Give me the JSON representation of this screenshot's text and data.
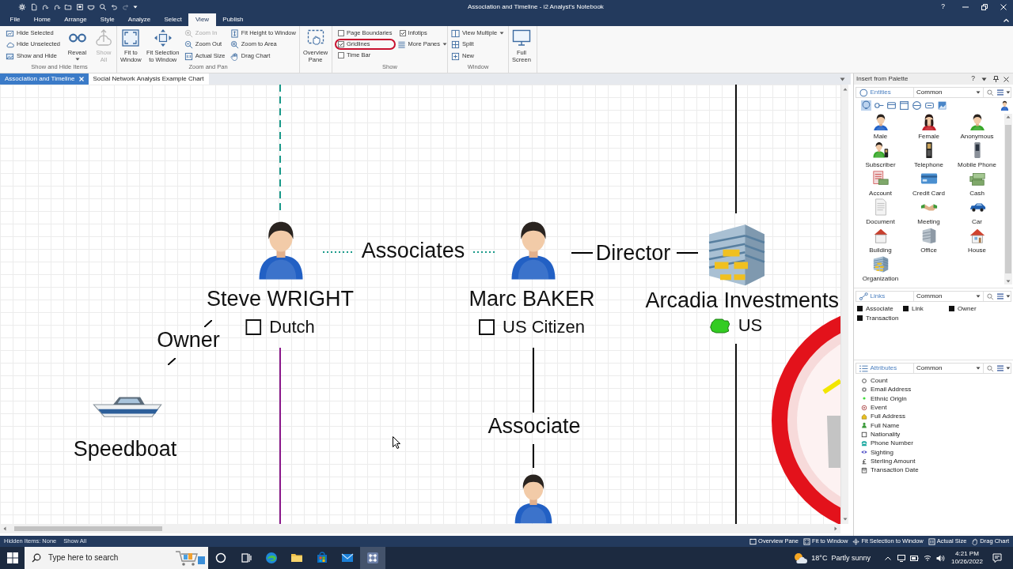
{
  "window": {
    "title": "Association and Timeline - i2 Analyst's Notebook",
    "help": "?"
  },
  "menu_tabs": [
    {
      "label": "File",
      "selected": false
    },
    {
      "label": "Home",
      "selected": false
    },
    {
      "label": "Arrange",
      "selected": false
    },
    {
      "label": "Style",
      "selected": false
    },
    {
      "label": "Analyze",
      "selected": false
    },
    {
      "label": "Select",
      "selected": false
    },
    {
      "label": "View",
      "selected": true
    },
    {
      "label": "Publish",
      "selected": false
    }
  ],
  "ribbon": {
    "groups": [
      {
        "title": "Show and Hide Items",
        "columns": [
          [
            {
              "kind": "small",
              "label": "Hide Selected",
              "disabled": false,
              "dropdown": false
            },
            {
              "kind": "small",
              "label": "Hide Unselected",
              "disabled": false,
              "dropdown": false
            },
            {
              "kind": "small",
              "label": "Show and Hide",
              "disabled": false,
              "dropdown": false
            }
          ],
          [
            {
              "kind": "large",
              "label": "Reveal",
              "disabled": false,
              "dropdown": true
            }
          ],
          [
            {
              "kind": "large",
              "label": "Show\nAll",
              "disabled": true,
              "dropdown": false
            }
          ]
        ]
      },
      {
        "title": "Zoom and Pan",
        "columns": [
          [
            {
              "kind": "large",
              "label": "Fit to\nWindow",
              "disabled": false,
              "dropdown": false
            }
          ],
          [
            {
              "kind": "large",
              "label": "Fit Selection\nto Window",
              "disabled": false,
              "dropdown": false
            }
          ],
          [
            {
              "kind": "small",
              "label": "Zoom In",
              "disabled": true,
              "dropdown": false
            },
            {
              "kind": "small",
              "label": "Zoom Out",
              "disabled": false,
              "dropdown": false
            },
            {
              "kind": "small",
              "label": "Actual Size",
              "disabled": false,
              "dropdown": false
            }
          ],
          [
            {
              "kind": "small",
              "label": "Fit Height to Window",
              "disabled": false,
              "dropdown": false
            },
            {
              "kind": "small",
              "label": "Zoom to Area",
              "disabled": false,
              "dropdown": false
            },
            {
              "kind": "small",
              "label": "Drag Chart",
              "disabled": false,
              "dropdown": false
            }
          ]
        ]
      },
      {
        "columns": [
          [
            {
              "kind": "large",
              "label": "Overview\nPane",
              "disabled": false,
              "dropdown": false
            }
          ]
        ]
      },
      {
        "title": "Show",
        "columns": [
          [
            {
              "kind": "check",
              "label": "Page Boundaries",
              "checked": false,
              "highlighted": false
            },
            {
              "kind": "check",
              "label": "Gridlines",
              "checked": true,
              "highlighted": true
            },
            {
              "kind": "check",
              "label": "Time Bar",
              "checked": false,
              "highlighted": false
            }
          ],
          [
            {
              "kind": "check",
              "label": "Infotips",
              "checked": true,
              "highlighted": false
            },
            {
              "kind": "small",
              "label": "More Panes",
              "disabled": false,
              "dropdown": true
            }
          ]
        ]
      },
      {
        "title": "Window",
        "columns": [
          [
            {
              "kind": "small",
              "label": "View Multiple",
              "disabled": false,
              "dropdown": true
            },
            {
              "kind": "small",
              "label": "Split",
              "disabled": false,
              "dropdown": false
            },
            {
              "kind": "small",
              "label": "New",
              "disabled": false,
              "dropdown": false
            }
          ]
        ]
      },
      {
        "columns": [
          [
            {
              "kind": "large",
              "label": "Full\nScreen",
              "disabled": false,
              "dropdown": false
            }
          ]
        ]
      }
    ]
  },
  "doc_tabs": [
    {
      "label": "Association and Timeline",
      "selected": true
    },
    {
      "label": "Social Network Analysis Example Chart",
      "selected": false
    }
  ],
  "chart": {
    "entities": [
      {
        "label": "Steve WRIGHT",
        "attribute": "Dutch"
      },
      {
        "label": "Marc BAKER",
        "attribute": "US Citizen"
      },
      {
        "label": "Arcadia Investments",
        "attribute": "US"
      },
      {
        "label": "Speedboat"
      }
    ],
    "links": [
      {
        "label": "Associates",
        "kind": "dotted",
        "color": "#1a9a8a"
      },
      {
        "label": "Director",
        "kind": "solid",
        "color": "#000000"
      },
      {
        "label": "Owner",
        "kind": "solid",
        "color": "#000000"
      },
      {
        "label": "Associate",
        "kind": "solid",
        "color": "#000000"
      }
    ]
  },
  "palette": {
    "title": "Insert from Palette",
    "help": "?",
    "entities": {
      "label": "Entities",
      "filter": "Common",
      "type_buttons": [
        {
          "selected": true
        },
        {
          "selected": false
        },
        {
          "selected": false
        },
        {
          "selected": false
        },
        {
          "selected": false
        },
        {
          "selected": false
        },
        {
          "selected": false
        }
      ],
      "items": [
        "Male",
        "Female",
        "Anonymous",
        "Subscriber",
        "Telephone",
        "Mobile Phone",
        "Account",
        "Credit Card",
        "Cash",
        "Document",
        "Meeting",
        "Car",
        "Building",
        "Office",
        "House",
        "Organization"
      ]
    },
    "links": {
      "label": "Links",
      "filter": "Common",
      "items": [
        "Associate",
        "Link",
        "Owner",
        "Transaction"
      ]
    },
    "attributes": {
      "label": "Attributes",
      "filter": "Common",
      "items": [
        "Count",
        "Email Address",
        "Ethnic Origin",
        "Event",
        "Full Address",
        "Full Name",
        "Nationality",
        "Phone Number",
        "Sighting",
        "Sterling Amount",
        "Transaction Date"
      ]
    }
  },
  "status_bar": {
    "hidden_items": "Hidden Items: None",
    "show_all": "Show All",
    "buttons": [
      "Overview Pane",
      "Fit to Window",
      "Fit Selection to Window",
      "Actual Size",
      "Drag Chart"
    ]
  },
  "taskbar": {
    "search": {
      "placeholder": "Type here to search"
    },
    "apps": [
      {
        "selected": false
      },
      {
        "selected": false
      },
      {
        "selected": false
      },
      {
        "selected": false
      },
      {
        "selected": false
      },
      {
        "selected": false
      },
      {
        "selected": true
      }
    ],
    "weather": {
      "temperature": "18°C",
      "condition": "Partly sunny"
    },
    "time": "4:21 PM",
    "date": "10/26/2022"
  }
}
